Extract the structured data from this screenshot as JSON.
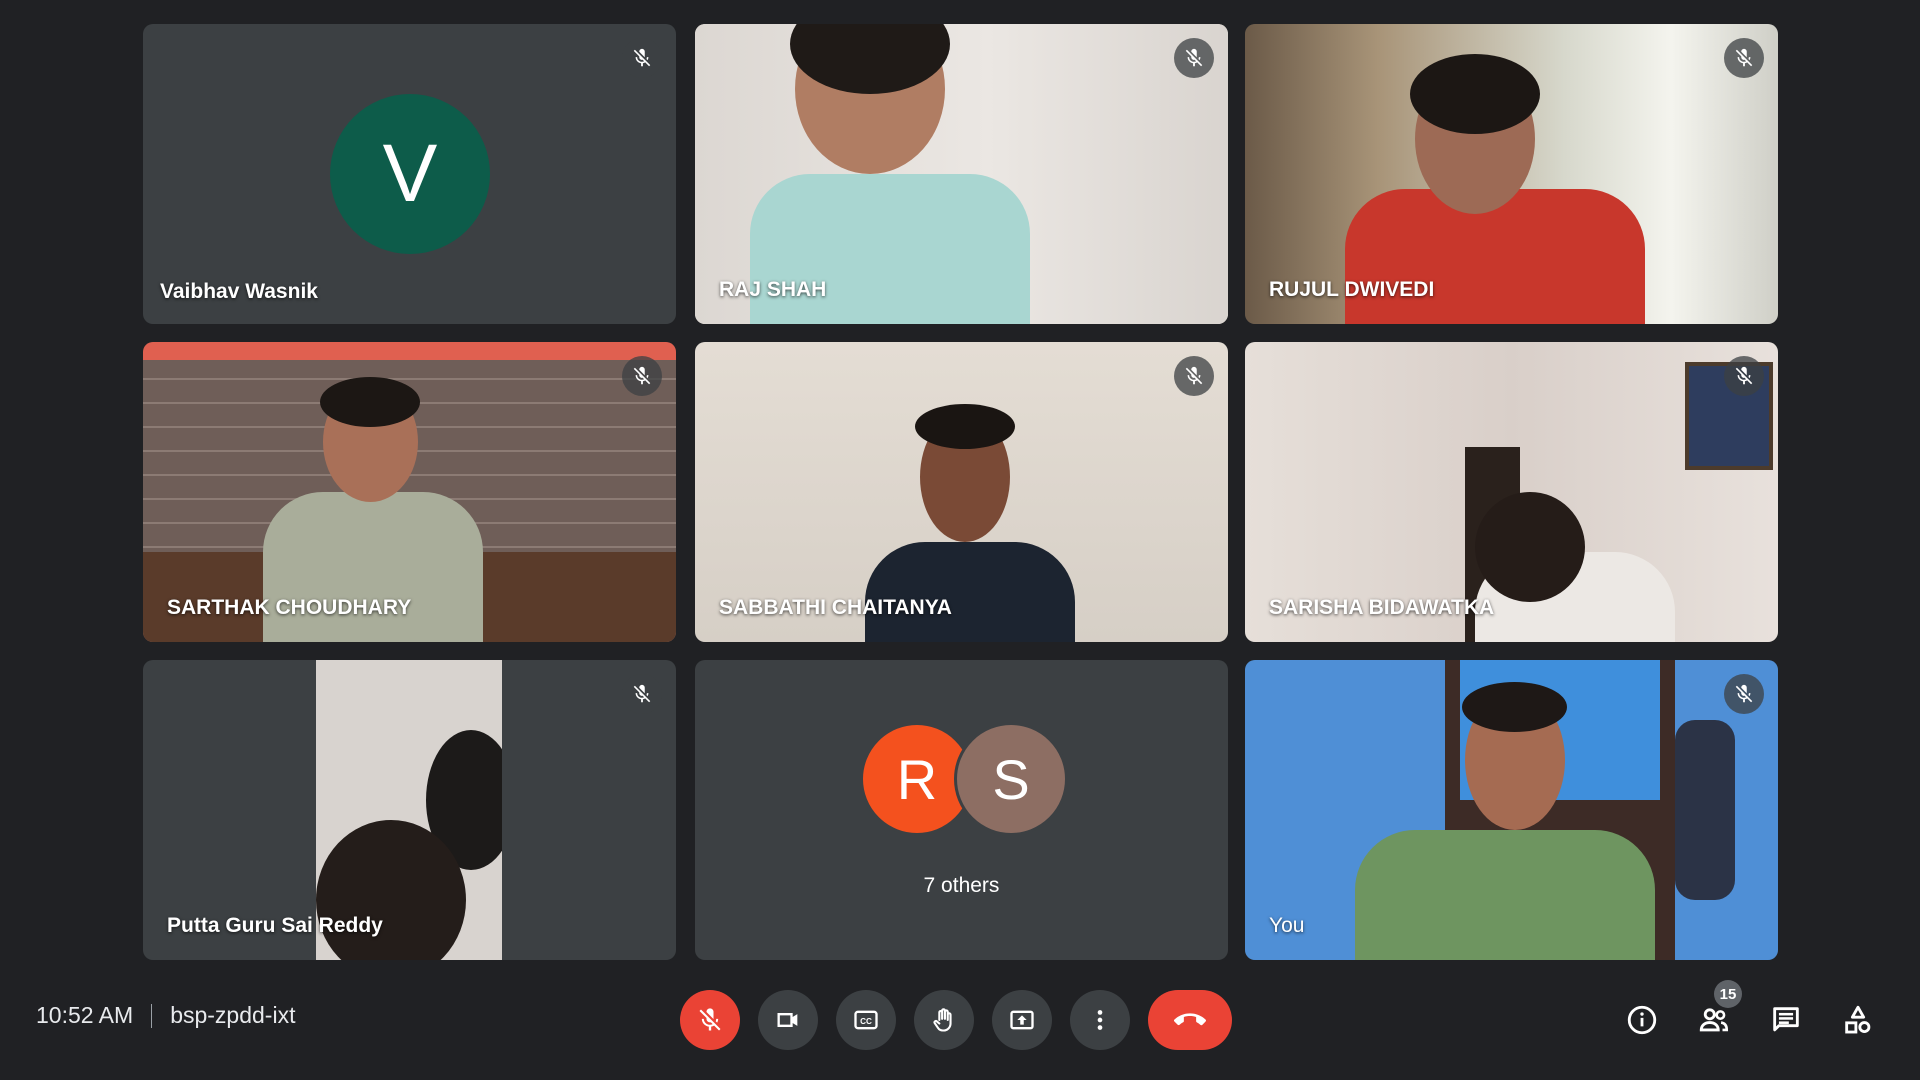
{
  "tiles": [
    {
      "name": "Vaibhav Wasnik",
      "avatar_letter": "V",
      "avatar_color": "#0d5c4a"
    },
    {
      "name": "RAJ SHAH"
    },
    {
      "name": "RUJUL DWIVEDI"
    },
    {
      "name": "SARTHAK CHOUDHARY"
    },
    {
      "name": "SABBATHI CHAITANYA"
    },
    {
      "name": "SARISHA BIDAWATKA"
    },
    {
      "name": "Putta Guru Sai Reddy"
    },
    {
      "others_label": "7 others",
      "avatars": [
        {
          "letter": "R",
          "color": "#f4511e"
        },
        {
          "letter": "S",
          "color": "#8d6e63"
        }
      ]
    },
    {
      "name": "You"
    }
  ],
  "meeting": {
    "time": "10:52 AM",
    "code": "bsp-zpdd-ixt"
  },
  "controls": {
    "mic": "mic-off-icon",
    "camera": "videocam-icon",
    "captions": "closed-captions-icon",
    "raise_hand": "raise-hand-icon",
    "present": "present-screen-icon",
    "more": "more-vert-icon",
    "leave": "end-call-icon"
  },
  "right_controls": {
    "participants_count": "15"
  },
  "colors": {
    "background": "#202124",
    "tile": "#3c4043",
    "danger": "#ea4335"
  }
}
